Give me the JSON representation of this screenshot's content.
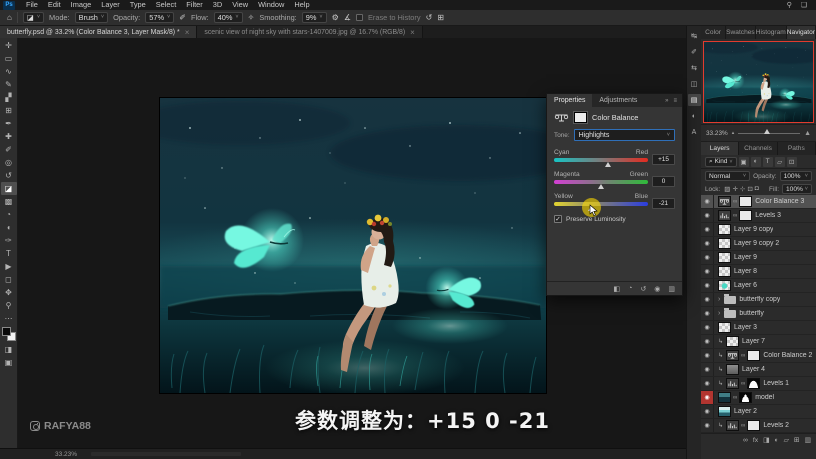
{
  "app": {
    "logo_text": "Ps"
  },
  "ui": {
    "caret": "˅",
    "close_glyph": "×",
    "eye_glyph": "◉",
    "chain_glyph": "∞",
    "clip_glyph": "↳",
    "group_arrow_glyph": "›",
    "check_glyph": "✓",
    "collapse_glyph": "»",
    "menu_glyph": "≡",
    "small_mountain": "▴",
    "large_mountain": "▲"
  },
  "colors": {
    "accent_blue": "#2f6fb8",
    "selected_layer_gray": "#525252",
    "glow_teal": "#5df2da",
    "red_eye_highlight": "#b23530",
    "navigator_border": "#e23b2e",
    "highlight_yellow": "#ffdc00"
  },
  "menubar": {
    "items": [
      "File",
      "Edit",
      "Image",
      "Layer",
      "Type",
      "Select",
      "Filter",
      "3D",
      "View",
      "Window",
      "Help"
    ]
  },
  "topbar_right": {
    "search_icon": "⚲",
    "workspace_icon": "❏"
  },
  "options": {
    "home_icon": "⌂",
    "tool_icon": "◪",
    "mode_label": "Mode:",
    "mode_value": "Brush",
    "opacity_label": "Opacity:",
    "opacity_value": "57%",
    "pressure_icon": "✐",
    "flow_label": "Flow:",
    "flow_value": "40%",
    "airbrush_icon": "✧",
    "smoothing_label": "Smoothing:",
    "smoothing_value": "9%",
    "gear_icon": "⚙",
    "angle_icon": "∡",
    "erase_history_label": "Erase to History",
    "history_icon": "↺",
    "tablet_icon": "⊞"
  },
  "tabs": [
    {
      "title": "butterfly.psd @ 33.2% (Color Balance 3, Layer Mask/8) *"
    },
    {
      "title": "scenic view of night sky with stars-1407009.jpg @ 16.7% (RGB/8)"
    }
  ],
  "toolbar": {
    "tools": [
      {
        "name": "move-tool-icon",
        "glyph": "✛"
      },
      {
        "name": "marquee-tool-icon",
        "glyph": "▭"
      },
      {
        "name": "lasso-tool-icon",
        "glyph": "∿"
      },
      {
        "name": "quick-selection-tool-icon",
        "glyph": "✎"
      },
      {
        "name": "crop-tool-icon",
        "glyph": "▞"
      },
      {
        "name": "frame-tool-icon",
        "glyph": "⊞"
      },
      {
        "name": "eyedropper-tool-icon",
        "glyph": "✒"
      },
      {
        "name": "healing-brush-tool-icon",
        "glyph": "✚"
      },
      {
        "name": "brush-tool-icon",
        "glyph": "✐"
      },
      {
        "name": "clone-stamp-tool-icon",
        "glyph": "◎"
      },
      {
        "name": "history-brush-tool-icon",
        "glyph": "↺"
      },
      {
        "name": "eraser-tool-icon",
        "glyph": "◪",
        "selected": true
      },
      {
        "name": "gradient-tool-icon",
        "glyph": "▩"
      },
      {
        "name": "blur-tool-icon",
        "glyph": "◔"
      },
      {
        "name": "dodge-tool-icon",
        "glyph": "◖"
      },
      {
        "name": "pen-tool-icon",
        "glyph": "✑"
      },
      {
        "name": "type-tool-icon",
        "glyph": "T"
      },
      {
        "name": "path-selection-tool-icon",
        "glyph": "▶"
      },
      {
        "name": "shape-tool-icon",
        "glyph": "◻"
      },
      {
        "name": "hand-tool-icon",
        "glyph": "✥"
      },
      {
        "name": "zoom-tool-icon",
        "glyph": "⚲"
      },
      {
        "name": "edit-toolbar-icon",
        "glyph": "⋯"
      }
    ],
    "tools_bottom": [
      {
        "name": "quick-mask-icon",
        "glyph": "◨"
      },
      {
        "name": "screen-mode-icon",
        "glyph": "▣"
      }
    ]
  },
  "panel_strip": [
    {
      "name": "panel-history-icon",
      "glyph": "↹"
    },
    {
      "name": "panel-brush-settings-icon",
      "glyph": "✐"
    },
    {
      "name": "panel-clone-source-icon",
      "glyph": "⇆"
    },
    {
      "name": "panel-libraries-icon",
      "glyph": "◫"
    },
    {
      "name": "panel-properties-icon",
      "glyph": "▤",
      "selected": true
    },
    {
      "name": "panel-adjustments-icon",
      "glyph": "◐"
    },
    {
      "name": "panel-character-icon",
      "glyph": "A"
    }
  ],
  "right": {
    "panel_tabs": [
      "Color",
      "Swatches",
      "Histogram",
      "Navigator"
    ],
    "panel_tabs_active": 3,
    "navigator": {
      "zoom": "33.23%"
    },
    "layers_tabs": [
      "Layers",
      "Channels",
      "Paths"
    ],
    "layers_tabs_active": 0,
    "filter": {
      "search_icon": "⌕",
      "kind_label": "Kind",
      "icons": [
        {
          "name": "filter-pixel-icon",
          "glyph": "▣"
        },
        {
          "name": "filter-adjustment-icon",
          "glyph": "◐"
        },
        {
          "name": "filter-type-icon",
          "glyph": "T"
        },
        {
          "name": "filter-shape-icon",
          "glyph": "▱"
        },
        {
          "name": "filter-smart-icon",
          "glyph": "⊡"
        }
      ]
    },
    "blend_mode": "Normal",
    "opacity_label": "Opacity:",
    "opacity_value": "100%",
    "lock_label": "Lock:",
    "lock_icons": [
      {
        "name": "lock-transparent-icon",
        "glyph": "▨"
      },
      {
        "name": "lock-pixels-icon",
        "glyph": "✛"
      },
      {
        "name": "lock-position-icon",
        "glyph": "⊹"
      },
      {
        "name": "lock-artboard-icon",
        "glyph": "⊡"
      },
      {
        "name": "lock-all-icon",
        "glyph": "◘"
      }
    ],
    "fill_label": "Fill:",
    "fill_value": "100%"
  },
  "layers": {
    "rows": [
      {
        "label": "Color Balance 3",
        "kind": "balance",
        "mask": "white",
        "chain": true,
        "selected": true
      },
      {
        "label": "Levels 3",
        "kind": "levels",
        "mask": "white",
        "chain": true
      },
      {
        "label": "Layer 9 copy",
        "kind": "checker"
      },
      {
        "label": "Layer 9 copy 2",
        "kind": "checker"
      },
      {
        "label": "Layer 9",
        "kind": "checker"
      },
      {
        "label": "Layer 8",
        "kind": "checker"
      },
      {
        "label": "Layer 6",
        "kind": "checker-teal"
      },
      {
        "label": "butterfly copy",
        "kind": "group"
      },
      {
        "label": "butterfly",
        "kind": "group"
      },
      {
        "label": "Layer 3",
        "kind": "checker"
      },
      {
        "label": "Layer 7",
        "kind": "checker",
        "clipped": true
      },
      {
        "label": "Color Balance 2",
        "kind": "balance",
        "mask": "white",
        "chain": true,
        "clipped": true
      },
      {
        "label": "Layer 4",
        "kind": "gray",
        "clipped": true
      },
      {
        "label": "Levels 1",
        "kind": "levels",
        "mask": "mountain",
        "chain": true,
        "clipped": true
      },
      {
        "label": "model",
        "kind": "image",
        "mask": "figure",
        "chain": true,
        "red_eye": true
      },
      {
        "label": "Layer 2",
        "kind": "image-band"
      },
      {
        "label": "Levels 2",
        "kind": "levels",
        "mask": "white",
        "chain": true,
        "clipped": true
      }
    ],
    "footer_icons": [
      {
        "name": "link-layers-icon",
        "glyph": "∞"
      },
      {
        "name": "layer-effects-icon",
        "glyph": "fx"
      },
      {
        "name": "add-mask-icon",
        "glyph": "◨"
      },
      {
        "name": "new-adjustment-icon",
        "glyph": "◐"
      },
      {
        "name": "new-group-icon",
        "glyph": "▱"
      },
      {
        "name": "new-layer-icon",
        "glyph": "⊞"
      },
      {
        "name": "delete-layer-icon",
        "glyph": "▥"
      }
    ]
  },
  "properties": {
    "tabs": [
      "Properties",
      "Adjustments"
    ],
    "title": "Color Balance",
    "tone_label": "Tone:",
    "tone_value": "Highlights",
    "sliders": [
      {
        "left": "Cyan",
        "right": "Red",
        "value": "+15",
        "pos": 57.5
      },
      {
        "left": "Magenta",
        "right": "Green",
        "value": "0",
        "pos": 50
      },
      {
        "left": "Yellow",
        "right": "Blue",
        "value": "-21",
        "pos": 39.5,
        "highlight": true
      }
    ],
    "preserve_label": "Preserve Luminosity",
    "preserve_checked": true,
    "footer_icons": [
      {
        "name": "clip-to-layer-icon",
        "glyph": "◧"
      },
      {
        "name": "view-previous-state-icon",
        "glyph": "◔"
      },
      {
        "name": "reset-icon",
        "glyph": "↺"
      },
      {
        "name": "visibility-icon",
        "glyph": "◉"
      },
      {
        "name": "delete-adjustment-icon",
        "glyph": "▥"
      }
    ]
  },
  "caption": {
    "text": "参数调整为：+15 0 -21"
  },
  "watermark": {
    "text": "RAFYA88"
  },
  "statusbar": {
    "zoom": "33.23%"
  }
}
